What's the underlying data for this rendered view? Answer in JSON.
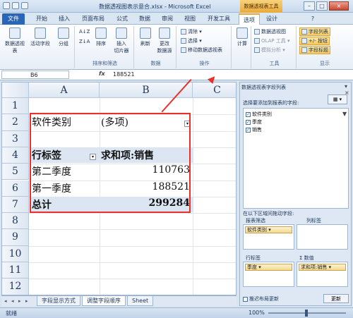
{
  "window": {
    "title": "数据透视图表示意合.xlsx - Microsoft Excel",
    "context_tab_title": "数据透视表工具",
    "controls": [
      "–",
      "□",
      "×"
    ]
  },
  "ribbon_tabs": [
    "文件",
    "开始",
    "插入",
    "页面布局",
    "公式",
    "数据",
    "审阅",
    "视图",
    "开发工具",
    "选项",
    "设计"
  ],
  "ribbon": {
    "groups": {
      "pivot": {
        "label": "",
        "buttons": [
          "数据透视表",
          "活动字段",
          "分组"
        ]
      },
      "sort": {
        "label": "排序和筛选",
        "az": "A↓Z",
        "za": "Z↓A",
        "sort": "排序",
        "slicer": "插入\n切片器"
      },
      "data": {
        "label": "数据",
        "refresh": "刷新",
        "change_source": "更改\n数据源"
      },
      "actions": {
        "label": "操作",
        "items": [
          "清除 ▾",
          "选择 ▾",
          "移动数据透视表"
        ]
      },
      "calc": {
        "label": "",
        "button": "计算"
      },
      "tools": {
        "label": "工具",
        "items": [
          "数据透视图",
          "OLAP 工具 ▾",
          "模拟分析 ▾"
        ]
      },
      "show": {
        "label": "显示",
        "items": [
          "字段列表",
          "+/- 按钮",
          "字段标题"
        ]
      }
    }
  },
  "formula_bar": {
    "name_box": "B6",
    "fx": "fx",
    "value": "188521"
  },
  "sheet": {
    "columns": [
      "A",
      "B",
      "C"
    ],
    "rows": [
      "1",
      "2",
      "3",
      "4",
      "5",
      "6",
      "7",
      "8",
      "9",
      "10",
      "11",
      "12"
    ],
    "cells": {
      "a2": "软件类别",
      "b2": "(多项)",
      "a4": "行标签",
      "b4": "求和项:销售",
      "a5": "第二季度",
      "b5": "110763",
      "a6": "第一季度",
      "b6": "188521",
      "a7": "总计",
      "b7": "299284"
    },
    "tabs": [
      "字段显示方式",
      "调整字段顺序",
      "Sheet"
    ],
    "active_tab": "调整字段顺序"
  },
  "pane": {
    "title": "数据透视表字段列表",
    "prompt": "选择要添加到报表的字段:",
    "fields": [
      {
        "label": "软件类别",
        "checked": "✓"
      },
      {
        "label": "季度",
        "checked": "✓"
      },
      {
        "label": "销售",
        "checked": "✓"
      }
    ],
    "drag_prompt": "在以下区域间拖动字段:",
    "areas": {
      "filter": {
        "label": "报表筛选",
        "item": "软件类别 ▾"
      },
      "column": {
        "label": "列标签",
        "item": ""
      },
      "row": {
        "label": "行标签",
        "item": "季度 ▾"
      },
      "values": {
        "label": "Σ 数值",
        "item": "求和项:销售 ▾"
      }
    },
    "defer": "推迟布局更新",
    "update": "更新"
  },
  "status": {
    "text": "就绪",
    "zoom": "100%"
  },
  "colors": {
    "file_tab": "#2a66b7",
    "highlight": "#e8312a",
    "pivot_header": "#dce6f2"
  }
}
